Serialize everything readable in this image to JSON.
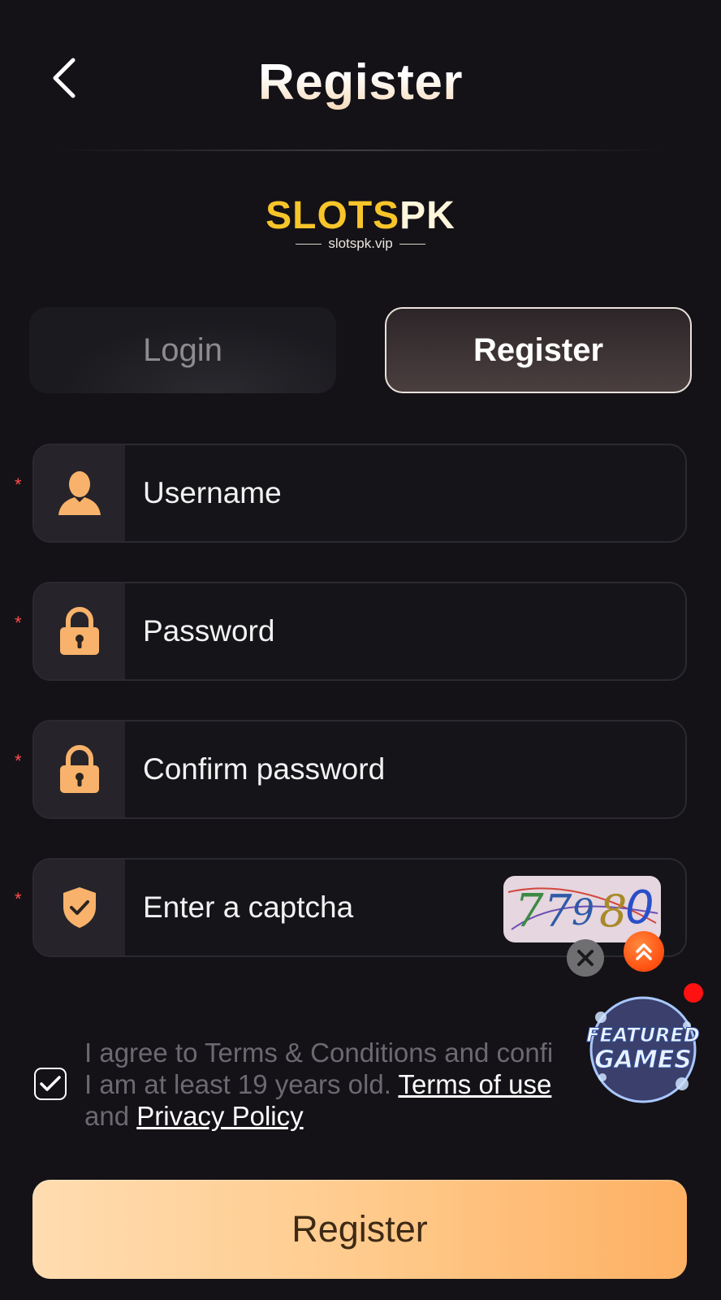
{
  "header": {
    "title": "Register"
  },
  "logo": {
    "brand_yellow": "SLOTS",
    "brand_white": "PK",
    "domain": "slotspk.vip"
  },
  "tabs": [
    {
      "label": "Login",
      "active": false
    },
    {
      "label": "Register",
      "active": true
    }
  ],
  "form": {
    "required_mark": "*",
    "username": {
      "placeholder": "Username"
    },
    "password": {
      "placeholder": "Password"
    },
    "confirm_password": {
      "placeholder": "Confirm password"
    },
    "captcha": {
      "placeholder": "Enter a captcha",
      "code": "77980"
    }
  },
  "agreement": {
    "checked": true,
    "text_1": "I agree to Terms & Conditions and confi",
    "text_2": "I am at least 19 years old.",
    "terms_link": "Terms of use",
    "text_3": "and",
    "privacy_link": "Privacy Policy"
  },
  "promo": {
    "line1": "FEATURED",
    "line2": "GAMES"
  },
  "submit": {
    "label": "Register"
  },
  "colors": {
    "background": "#141217",
    "accent_orange": "#ffcb8d",
    "logo_yellow": "#f7c52a",
    "required_red": "#ff4d4d",
    "icon_orange": "#f9b26b"
  }
}
